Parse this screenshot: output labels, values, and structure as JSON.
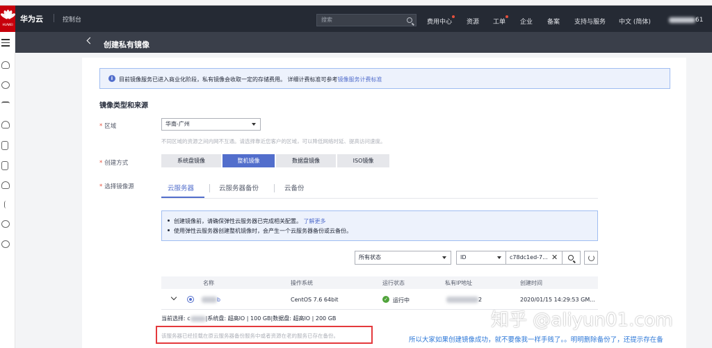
{
  "topbar": {
    "logo_text": "HUAWEI",
    "brand": "华为云",
    "console": "控制台",
    "search_placeholder": "搜索",
    "nav": [
      "费用中心",
      "资源",
      "工单",
      "企业",
      "备案",
      "支持与服务",
      "中文 (简体)"
    ],
    "account_suffix": "61"
  },
  "header": {
    "title": "创建私有镜像"
  },
  "info": {
    "text": "目前镜像服务已进入商业化阶段，私有镜像会收取一定的存储费用。 详细计费标准可参考",
    "link": "镜像服务计费标准"
  },
  "section_title": "镜像类型和来源",
  "region": {
    "label": "区域",
    "value": "华南-广州",
    "hint": "不同区域的资源之间内网不互通。请选择靠近您客户的区域，可以降低网络时延、提高访问速度。"
  },
  "create_method": {
    "label": "创建方式",
    "options": [
      "系统盘镜像",
      "整机镜像",
      "数据盘镜像",
      "ISO镜像"
    ],
    "active_index": 1
  },
  "source": {
    "label": "选择镜像源",
    "tabs": [
      "云服务器",
      "云服务器备份",
      "云备份"
    ],
    "active_index": 0
  },
  "notice": {
    "line1": "创建镜像前，请确保弹性云服务器已完成相关配置。",
    "line1_link": "了解更多",
    "line2": "使用弹性云服务器创建整机镜像时，会产生一个云服务器备份或云备份。"
  },
  "filter": {
    "status_select": "所有状态",
    "field_select": "ID",
    "search_value": "c78dc1ed-7..."
  },
  "table": {
    "headers": [
      "名称",
      "操作系统",
      "运行状态",
      "私有IP地址",
      "创建时间"
    ],
    "row": {
      "name_suffix": "b",
      "os": "CentOS 7.6 64bit",
      "status": "运行中",
      "ip_suffix": "2",
      "created": "2020/01/15 14:29:53 GM..."
    }
  },
  "current_selection": {
    "prefix": "当前选择: c",
    "suffix": "|系统盘: 超高IO | 100 GB|数据盘: 超高IO | 200 GB"
  },
  "warning": "该服务器已经挂载在原云服务器备份服务中或者资源在老的服务已存在备份。",
  "watermark": "知乎 @aliyun01.com",
  "annotation": "所以大家如果创建镜像成功，就不要像我一样手贱了。。明明删除备份了，还提示存在备",
  "colors": {
    "accent": "#526ecc",
    "topbar": "#252a34",
    "warning_border": "#e4393c",
    "running": "#50a33a"
  }
}
